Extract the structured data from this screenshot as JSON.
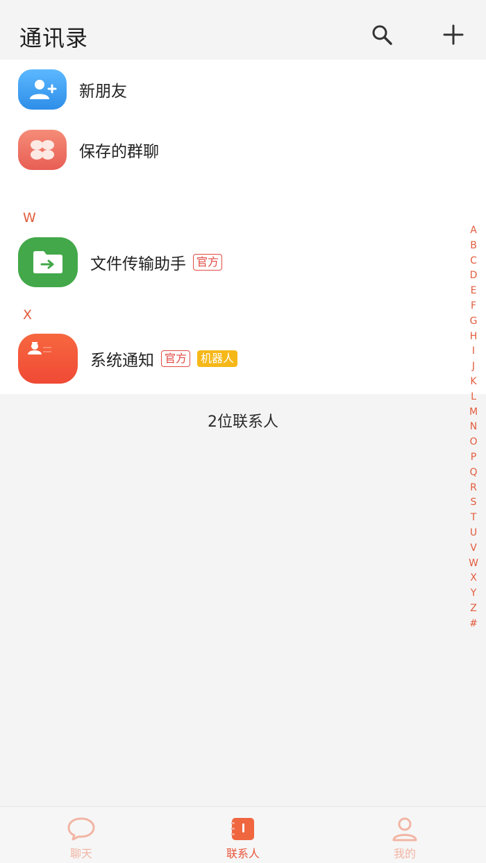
{
  "header": {
    "title": "通讯录",
    "search_icon": "search-icon",
    "add_icon": "plus-icon"
  },
  "top_items": [
    {
      "label": "新朋友",
      "icon": "add-user-icon",
      "color": "#3a9ef0"
    },
    {
      "label": "保存的群聊",
      "icon": "group-chat-icon",
      "color": "#f07a6a"
    }
  ],
  "sections": [
    {
      "letter": "W",
      "contacts": [
        {
          "name": "文件传输助手",
          "tags": [
            "官方"
          ],
          "icon": "folder-transfer-icon",
          "color": "#43a84a"
        }
      ]
    },
    {
      "letter": "X",
      "contacts": [
        {
          "name": "系统通知",
          "tags": [
            "官方",
            "机器人"
          ],
          "icon": "system-notice-icon",
          "color": "#f2543a"
        }
      ]
    }
  ],
  "contact_count": "2位联系人",
  "index_letters": [
    "A",
    "B",
    "C",
    "D",
    "E",
    "F",
    "G",
    "H",
    "I",
    "J",
    "K",
    "L",
    "M",
    "N",
    "O",
    "P",
    "Q",
    "R",
    "S",
    "T",
    "U",
    "V",
    "W",
    "X",
    "Y",
    "Z",
    "#"
  ],
  "tabs": [
    {
      "label": "聊天",
      "icon": "chat-bubble-icon",
      "active": false
    },
    {
      "label": "联系人",
      "icon": "contacts-book-icon",
      "active": true
    },
    {
      "label": "我的",
      "icon": "profile-icon",
      "active": false
    }
  ],
  "colors": {
    "accent": "#e25b3c",
    "tab_active": "#e8553a",
    "tab_inactive": "#f2b5a4"
  }
}
